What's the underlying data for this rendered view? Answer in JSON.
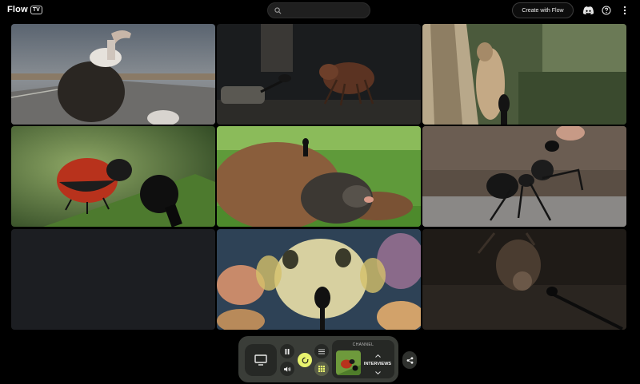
{
  "header": {
    "logo_word": "Flow",
    "logo_badge": "TV",
    "search": {
      "value": "",
      "placeholder": ""
    },
    "create_button": "Create with Flow",
    "icons": [
      "discord-icon",
      "help-icon",
      "more-vert-icon"
    ]
  },
  "tiles": [
    {
      "id": "vulture",
      "subject": "vulture-on-road"
    },
    {
      "id": "cockroach",
      "subject": "cockroach-with-microphone"
    },
    {
      "id": "cicada",
      "subject": "cicada-on-tree-bark"
    },
    {
      "id": "ladybug",
      "subject": "ladybug-with-microphone"
    },
    {
      "id": "mole",
      "subject": "mole-in-dirt-mound"
    },
    {
      "id": "ant",
      "subject": "ant-with-microphone"
    },
    {
      "id": "empty",
      "subject": "empty-loading-tile"
    },
    {
      "id": "pufferfish",
      "subject": "pufferfish-with-microphone"
    },
    {
      "id": "bat",
      "subject": "bat-with-microphone"
    }
  ],
  "controls": {
    "channel_label": "CHANNEL",
    "channel_name": "INTERVIEWS",
    "loop_active": true,
    "grid_view_active": true
  },
  "colors": {
    "background": "#000000",
    "panel": "#3a3d38",
    "button": "#262825",
    "accent": "#e8f36e"
  }
}
